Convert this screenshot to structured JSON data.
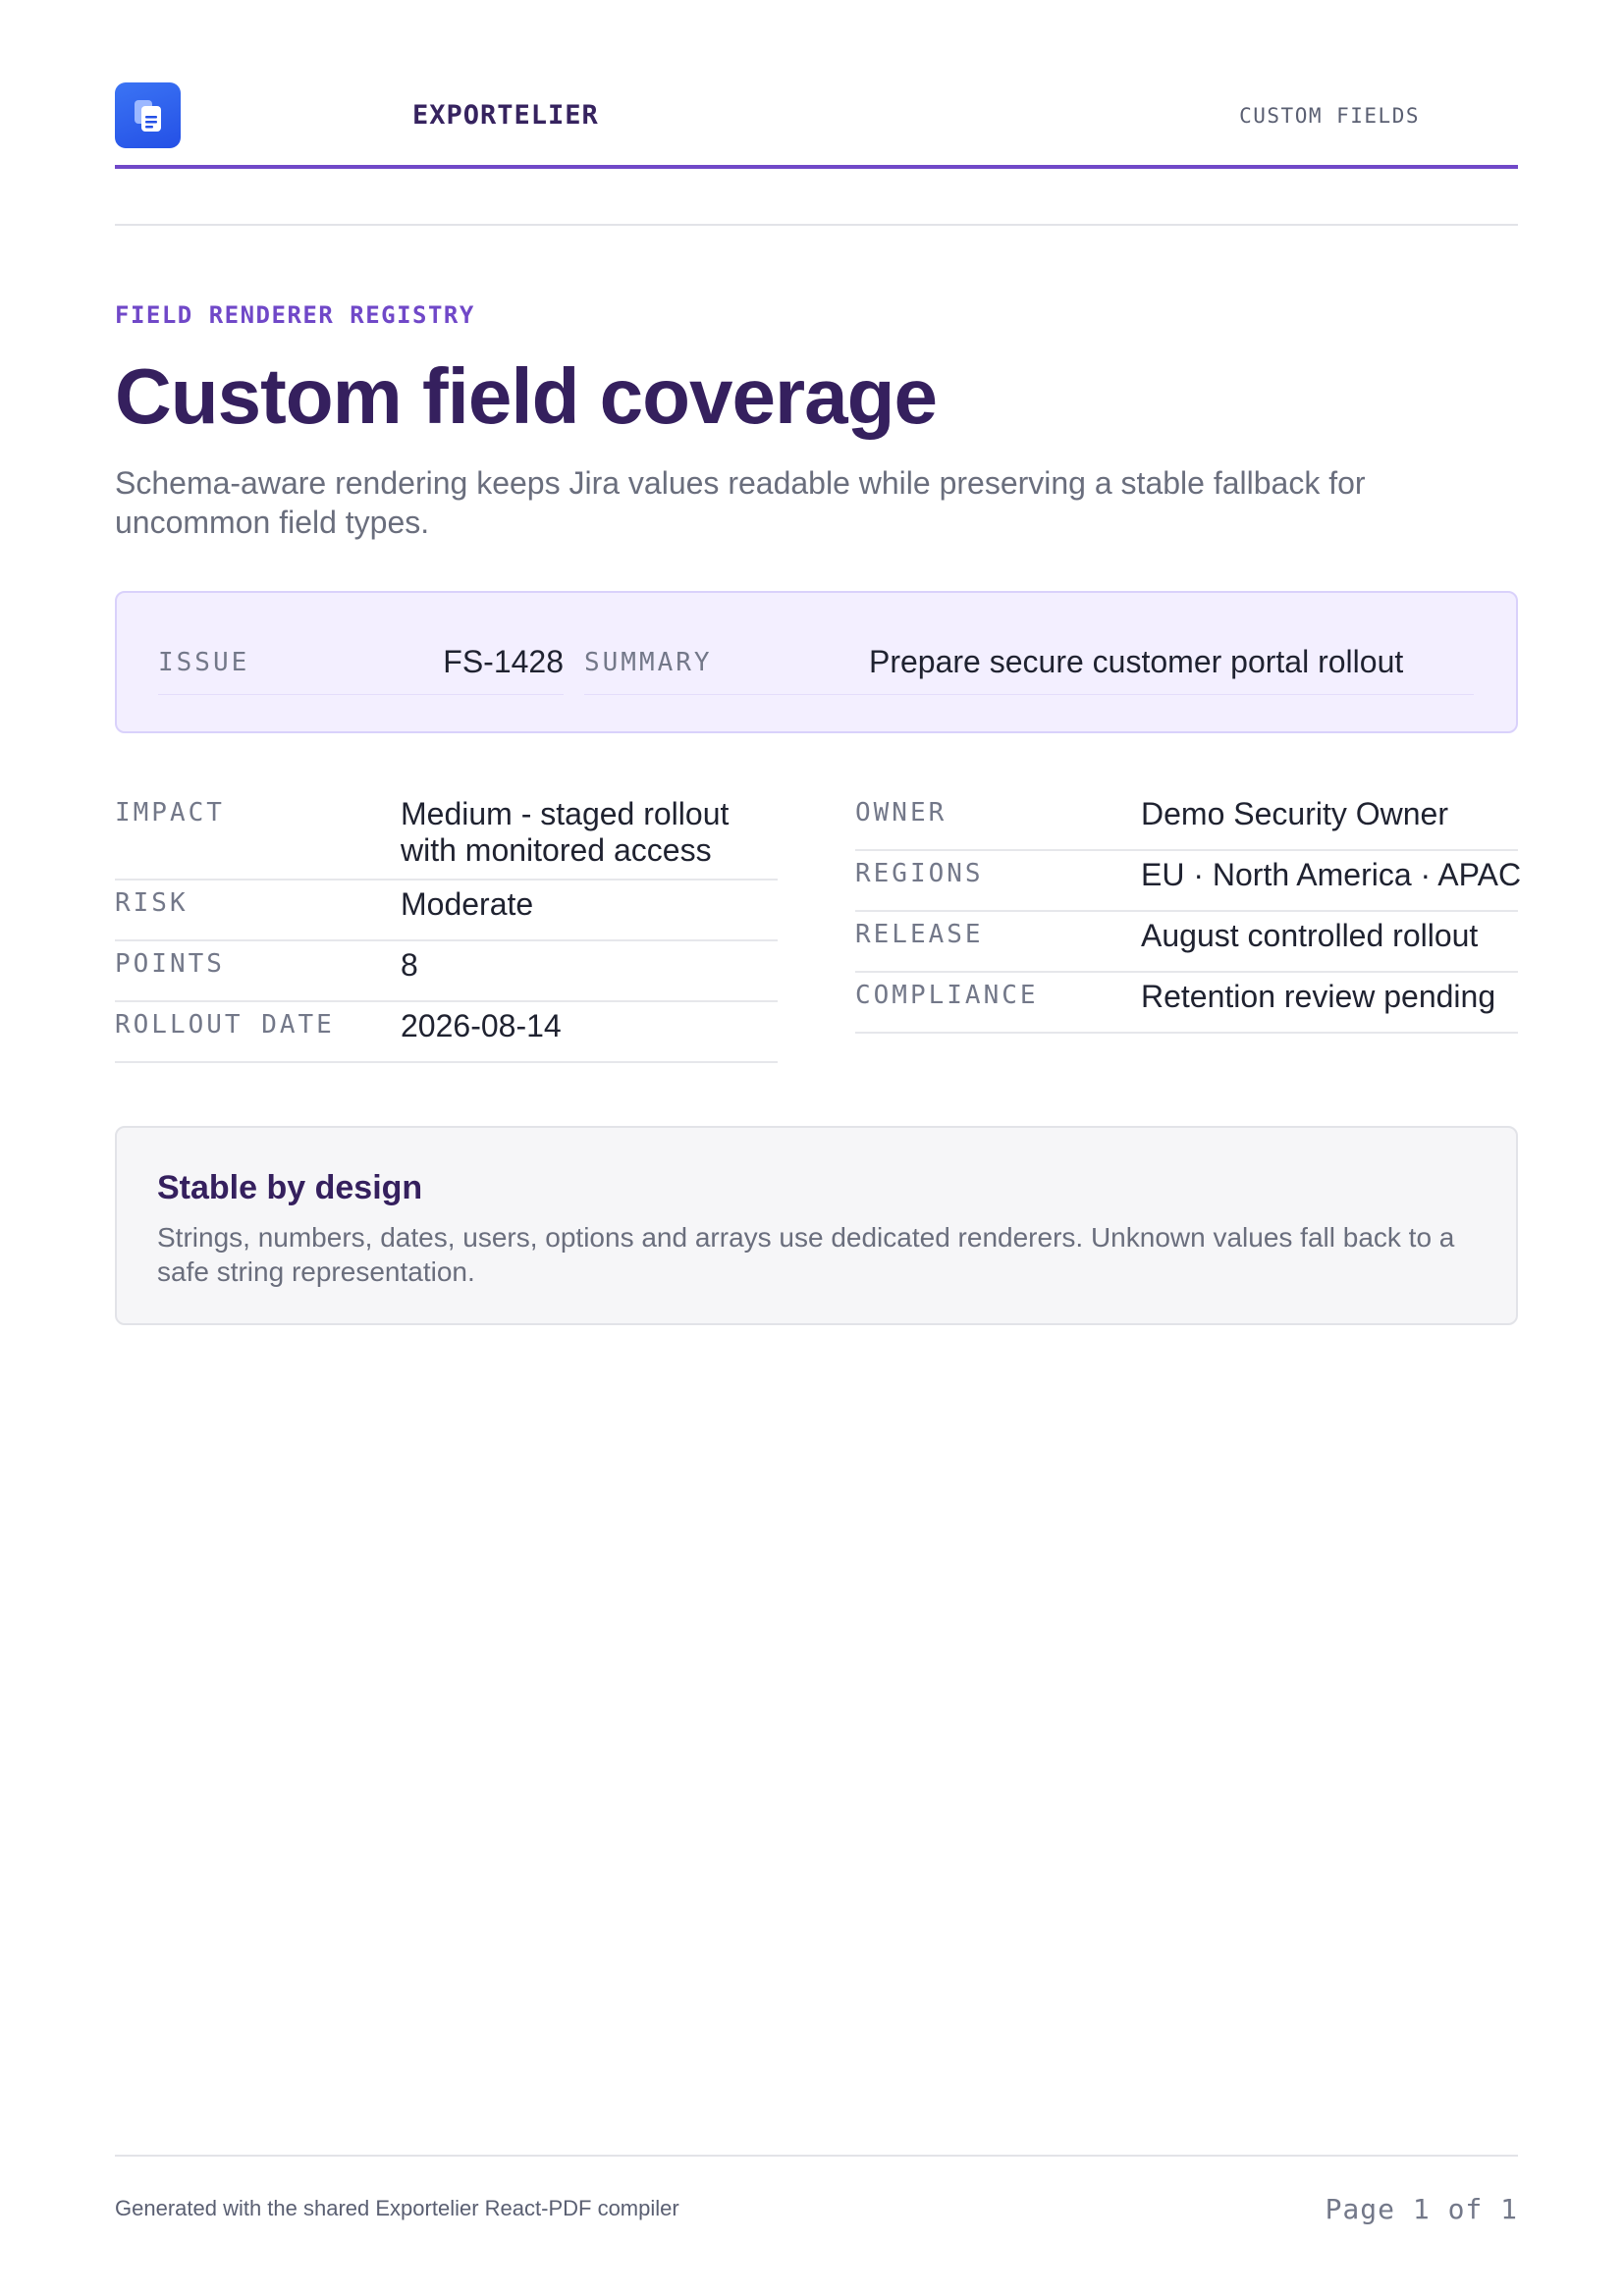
{
  "header": {
    "brand": "EXPORTELIER",
    "tag": "CUSTOM FIELDS",
    "logo_icon": "document-icon"
  },
  "hero": {
    "eyebrow": "FIELD RENDERER REGISTRY",
    "title": "Custom field coverage",
    "subtitle": "Schema-aware rendering keeps Jira values readable while preserving a stable fallback for uncommon field types."
  },
  "issue": {
    "key_label": "ISSUE",
    "key_value": "FS-1428",
    "summary_label": "SUMMARY",
    "summary_value": "Prepare secure customer portal rollout"
  },
  "fields_left": [
    {
      "label": "IMPACT",
      "value": "Medium - staged rollout with monitored access"
    },
    {
      "label": "RISK",
      "value": "Moderate"
    },
    {
      "label": "POINTS",
      "value": "8"
    },
    {
      "label": "ROLLOUT DATE",
      "value": "2026-08-14"
    }
  ],
  "fields_right": [
    {
      "label": "OWNER",
      "value": "Demo Security Owner"
    },
    {
      "label": "REGIONS",
      "value": "EU · North America · APAC"
    },
    {
      "label": "RELEASE",
      "value": "August controlled rollout"
    },
    {
      "label": "COMPLIANCE",
      "value": "Retention review pending"
    }
  ],
  "callout": {
    "title": "Stable by design",
    "body": "Strings, numbers, dates, users, options and arrays use dedicated renderers. Unknown values fall back to a safe string representation."
  },
  "footer": {
    "generated": "Generated with the shared Exportelier React-PDF compiler",
    "page": "Page 1 of 1"
  },
  "colors": {
    "accent": "#7048c8",
    "title": "#35205e",
    "logo": "#2450e6"
  }
}
